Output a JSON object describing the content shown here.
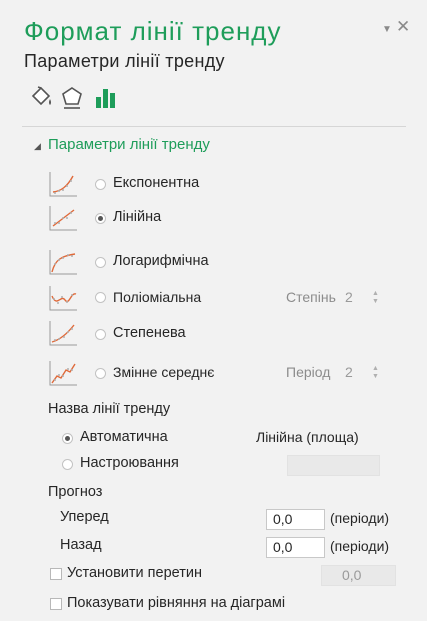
{
  "pane": {
    "title": "Формат лінії тренду",
    "subtitle": "Параметри лінії тренду",
    "pin_icon": "▼",
    "close_icon": "✕"
  },
  "tabs": [
    {
      "icon": "fill-bucket-icon"
    },
    {
      "icon": "pentagon-icon"
    },
    {
      "icon": "bar-chart-icon",
      "selected": true
    }
  ],
  "section": {
    "title": "Параметри лінії тренду",
    "collapse_glyph": "◢"
  },
  "types": [
    {
      "label": "Експонентна",
      "selected": false
    },
    {
      "label": "Лінійна",
      "selected": true
    },
    {
      "label": "Логарифмічна",
      "selected": false
    },
    {
      "label": "Поліоміальна",
      "selected": false,
      "param_label": "Степінь",
      "param_value": "2"
    },
    {
      "label": "Степенева",
      "selected": false
    },
    {
      "label": "Змінне середнє",
      "selected": false,
      "param_label": "Період",
      "param_value": "2"
    }
  ],
  "spin_arrows": "▲\n▼",
  "name_section": {
    "title": "Назва лінії тренду",
    "automatic_label": "Автоматична",
    "automatic_value": "Лінійна (площа)",
    "custom_label": "Настроювання",
    "custom_value": ""
  },
  "forecast": {
    "title": "Прогноз",
    "forward_label": "Уперед",
    "forward_value": "0,0",
    "backward_label": "Назад",
    "backward_value": "0,0",
    "units": "(періоди)"
  },
  "intercept": {
    "label": "Установити перетин",
    "value": "0,0"
  },
  "show_equation": {
    "label": "Показувати рівняння на діаграмі"
  },
  "colors": {
    "accent": "#1e9d5a",
    "panel": "#f2f2f2"
  }
}
